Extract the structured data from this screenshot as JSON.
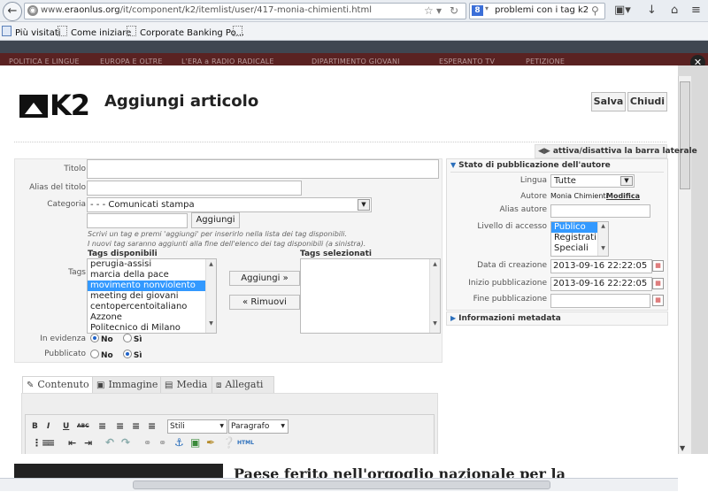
{
  "browser": {
    "url_prefix": "www.",
    "url_domain": "eraonlus.org",
    "url_path": "/it/component/k2/itemlist/user/417-monia-chimienti.html",
    "search_query": "problemi con i tag k2",
    "bookmarks": [
      "Più visitati",
      "Come iniziare",
      "Corporate Banking Po...",
      ""
    ]
  },
  "site": {
    "nav": [
      "POLITICA E LINGUE",
      "EUROPA E OLTRE",
      "L'ERA a RADIO RADICALE",
      "DIPARTIMENTO GIOVANI",
      "ESPERANTO TV",
      "PETIZIONE"
    ],
    "headline": "Paese ferito nell'orgoglio nazionale per la"
  },
  "modal": {
    "logo": "K2",
    "title": "Aggiungi articolo",
    "save_label": "Salva",
    "close_label": "Chiudi",
    "toggle_sidebar_label": "attiva/disattiva la barra laterale"
  },
  "form": {
    "title_label": "Titolo",
    "title_value": "",
    "alias_label": "Alias del titolo",
    "alias_value": "",
    "category_label": "Categoria",
    "category_value": "- - - Comunicati stampa",
    "tag_input_value": "",
    "add_tag_label": "Aggiungi",
    "tag_help_1": "Scrivi un tag e premi 'aggiungi' per inserirlo nella lista dei tag disponibili.",
    "tag_help_2": "I nuovi tag saranno aggiunti alla fine dell'elenco dei tag disponibili (a sinistra).",
    "tags_label": "Tags",
    "available_tags_label": "Tags disponibili",
    "selected_tags_label": "Tags selezionati",
    "available_tags": [
      "perugia-assisi",
      "marcia della pace",
      "movimento nonviolento",
      "meeting dei giovani",
      "centopercentoitaliano",
      "Azzone",
      "Politecnico di Milano"
    ],
    "selected_available_tag": "movimento nonviolento",
    "add_to_selected_label": "Aggiungi »",
    "remove_label": "« Rimuovi",
    "featured_label": "In evidenza",
    "published_label": "Pubblicato",
    "no_label": "No",
    "yes_label": "Sì",
    "featured_value": "No",
    "published_value": "Sì"
  },
  "publishing": {
    "header": "Stato di pubblicazione dell'autore",
    "language_label": "Lingua",
    "language_value": "Tutte",
    "author_label": "Autore",
    "author_value": "Monia Chimienti",
    "author_edit_label": "Modifica",
    "author_alias_label": "Alias autore",
    "author_alias_value": "",
    "access_label": "Livello di accesso",
    "access_options": [
      "Publico",
      "Registrati",
      "Speciali"
    ],
    "access_selected": "Publico",
    "created_label": "Data di creazione",
    "created_value": "2013-09-16 22:22:05",
    "publish_up_label": "Inizio pubblicazione",
    "publish_up_value": "2013-09-16 22:22:05",
    "publish_down_label": "Fine pubblicazione",
    "publish_down_value": "",
    "metadata_header": "Informazioni metadata"
  },
  "tabs": [
    "Contenuto",
    "Immagine",
    "Media",
    "Allegati"
  ],
  "editor": {
    "style_select": "Stili",
    "format_select": "Paragrafo",
    "bold": "B",
    "italic": "I",
    "underline": "U",
    "strike": "ABC",
    "html": "HTML"
  }
}
